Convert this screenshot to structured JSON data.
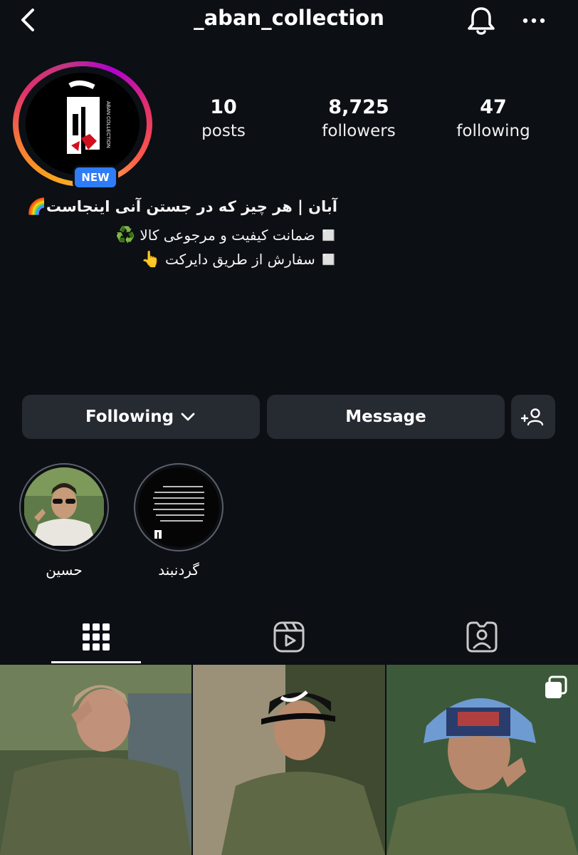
{
  "header": {
    "username": "_aban_collection",
    "back_icon": "chevron-left-icon",
    "bell_icon": "bell-icon",
    "more_icon": "more-horizontal-icon"
  },
  "profile": {
    "badge": "NEW",
    "logo_text": "آبان",
    "logo_subtext": "ABAN COLLECTION",
    "stats": [
      {
        "value": "10",
        "label": "posts"
      },
      {
        "value": "8,725",
        "label": "followers"
      },
      {
        "value": "47",
        "label": "following"
      }
    ]
  },
  "bio": {
    "line1": "آبان | هر چیز که در جستن آنی اینجاست",
    "line1_emoji": "🌈",
    "line2": "ضمانت کیفیت و مرجوعی کالا",
    "line2_emoji": "♻️",
    "line2_bullet": "◻️",
    "line3": "سفارش از طریق دایرکت",
    "line3_emoji": "👆",
    "line3_bullet": "◻️"
  },
  "actions": {
    "following_label": "Following",
    "message_label": "Message",
    "add_user_icon": "add-user-icon"
  },
  "highlights": [
    {
      "label": "حسین"
    },
    {
      "label": "گردنبند"
    }
  ],
  "tabs": [
    {
      "icon": "grid-icon",
      "active": true
    },
    {
      "icon": "reels-icon",
      "active": false
    },
    {
      "icon": "tagged-icon",
      "active": false
    }
  ],
  "posts": [
    {
      "description": "man in khaki cap"
    },
    {
      "description": "man in black nike cap"
    },
    {
      "description": "man in blue cap",
      "multi": true
    }
  ],
  "colors": {
    "background": "#0c0f14",
    "button": "#262a31",
    "badge": "#2e7cf6"
  }
}
